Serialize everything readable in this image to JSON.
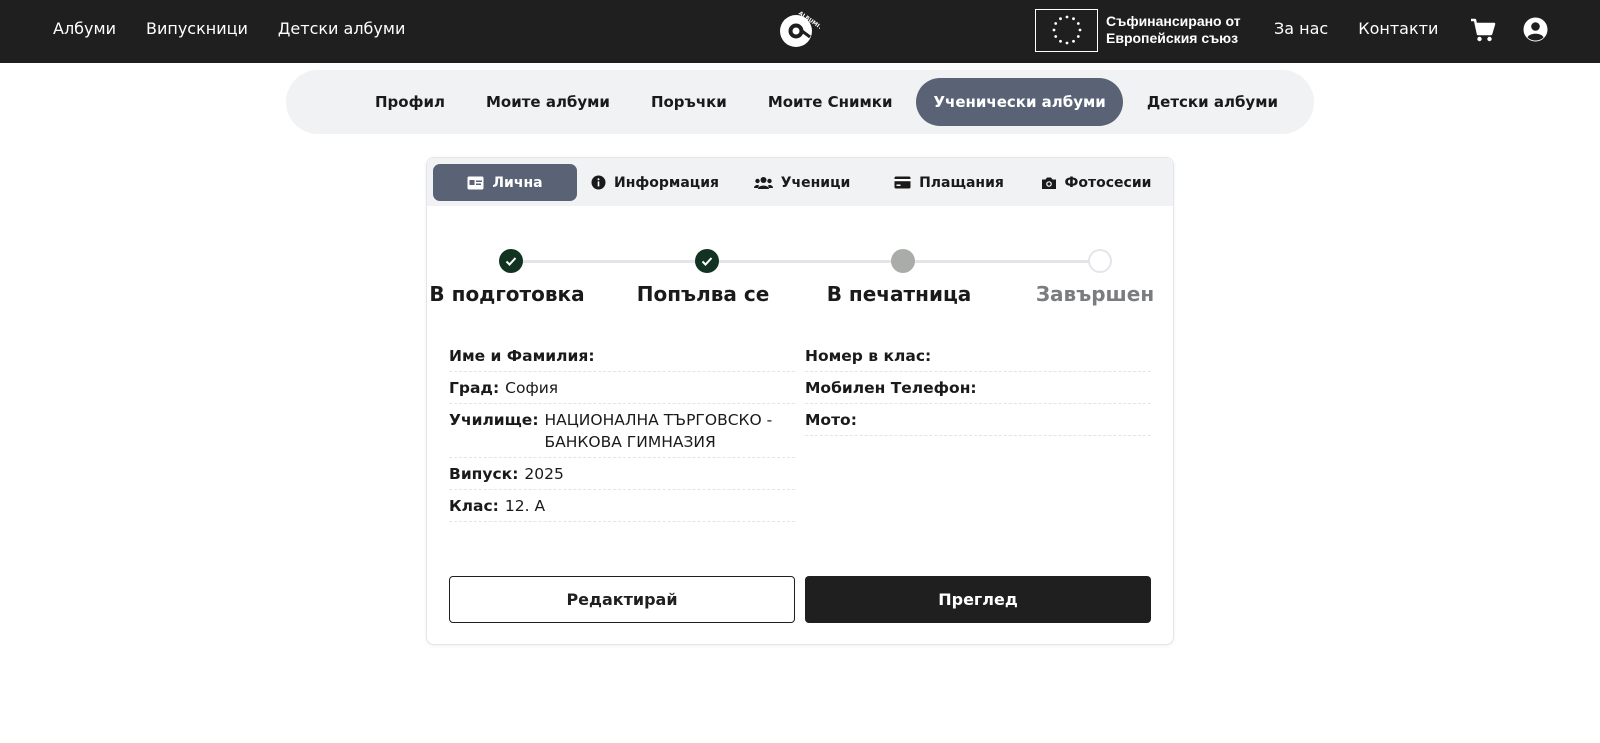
{
  "header": {
    "nav_left": [
      "Албуми",
      "Випускници",
      "Детски албуми"
    ],
    "logo_text": "ALBUMITE.BG",
    "eu_text_line1": "Съфинансирано от",
    "eu_text_line2": "Европейския съюз",
    "nav_right": [
      "За нас",
      "Контакти"
    ],
    "icons": [
      "cart-icon",
      "user-icon",
      "eu-flag-icon"
    ]
  },
  "subnav": {
    "items": [
      "Профил",
      "Моите албуми",
      "Поръчки",
      "Моите Снимки",
      "Ученически албуми",
      "Детски албуми"
    ],
    "active": "Ученически албуми"
  },
  "card": {
    "tabs": [
      {
        "label": "Лична",
        "icon": "id-card-icon"
      },
      {
        "label": "Информация",
        "icon": "info-icon"
      },
      {
        "label": "Ученици",
        "icon": "users-icon"
      },
      {
        "label": "Плащания",
        "icon": "credit-card-icon"
      },
      {
        "label": "Фотосесии",
        "icon": "camera-icon"
      }
    ],
    "active_tab": "Лична",
    "steps": [
      {
        "label": "В подготовка",
        "status": "done"
      },
      {
        "label": "Попълва се",
        "status": "done"
      },
      {
        "label": "В печатница",
        "status": "current"
      },
      {
        "label": "Завършен",
        "status": "todo"
      }
    ],
    "fields_left": [
      {
        "key": "Име и Фамилия:",
        "value": ""
      },
      {
        "key": "Град:",
        "value": "София"
      },
      {
        "key": "Училище:",
        "value": "НАЦИОНАЛНА ТЪРГОВСКО - БАНКОВА ГИМНАЗИЯ"
      },
      {
        "key": "Випуск:",
        "value": "2025"
      },
      {
        "key": "Клас:",
        "value": "12. А"
      }
    ],
    "fields_right": [
      {
        "key": "Номер в клас:",
        "value": ""
      },
      {
        "key": "Мобилен Телефон:",
        "value": ""
      },
      {
        "key": "Мото:",
        "value": ""
      }
    ],
    "edit_button": "Редактирай",
    "preview_button": "Преглед"
  },
  "colors": {
    "topbar": "#1f1f1f",
    "accent": "#5a6276",
    "step_done": "#123322"
  }
}
